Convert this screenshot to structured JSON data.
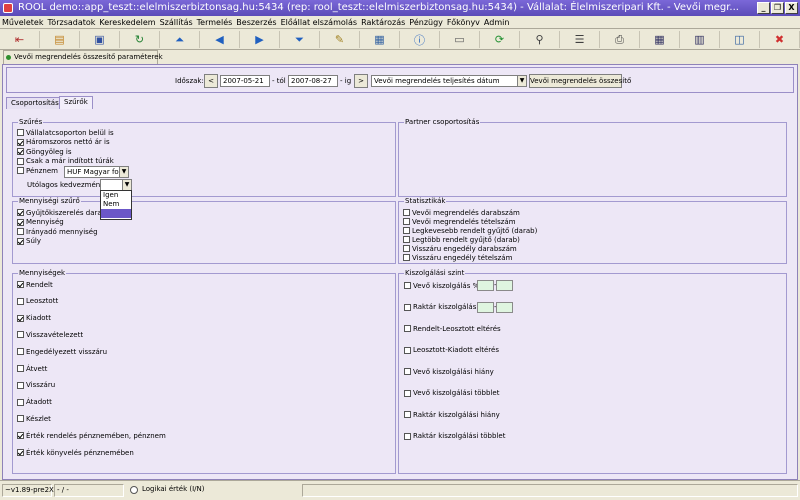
{
  "window": {
    "title": "ROOL demo::app_teszt::elelmiszerbiztonsag.hu:5434 (rep: rool_teszt::elelmiszerbiztonsag.hu:5434) - Vállalat: Élelmiszeripari Kft. - Vevői megr...",
    "minimize": "_",
    "restore": "❐",
    "close": "X"
  },
  "menu": [
    "Műveletek",
    "Törzsadatok",
    "Kereskedelem",
    "Szállítás",
    "Termelés",
    "Beszerzés",
    "Előállat elszámolás",
    "Raktározás",
    "Pénzügy",
    "Főkönyv",
    "Admin"
  ],
  "toolbar": [
    {
      "icon": "exit-icon",
      "glyph": "⇤",
      "color": "#b03030"
    },
    {
      "icon": "open-icon",
      "glyph": "▤",
      "color": "#c08020"
    },
    {
      "icon": "save-icon",
      "glyph": "▣",
      "color": "#3050a0"
    },
    {
      "icon": "refresh-icon",
      "glyph": "↻",
      "color": "#208030"
    },
    {
      "icon": "first-icon",
      "glyph": "⏶",
      "color": "#2060c0"
    },
    {
      "icon": "prev-icon",
      "glyph": "◀",
      "color": "#2060c0"
    },
    {
      "icon": "next-icon",
      "glyph": "▶",
      "color": "#2060c0"
    },
    {
      "icon": "last-icon",
      "glyph": "⏷",
      "color": "#2060c0"
    },
    {
      "icon": "edit-icon",
      "glyph": "✎",
      "color": "#a08020"
    },
    {
      "icon": "print-preview-icon",
      "glyph": "▦",
      "color": "#3060a0"
    },
    {
      "icon": "info-icon",
      "glyph": "ⓘ",
      "color": "#2060c0"
    },
    {
      "icon": "window-icon",
      "glyph": "▭",
      "color": "#606060"
    },
    {
      "icon": "sync-icon",
      "glyph": "⟳",
      "color": "#209030"
    },
    {
      "icon": "search-icon",
      "glyph": "⚲",
      "color": "#404040"
    },
    {
      "icon": "list-icon",
      "glyph": "☰",
      "color": "#404040"
    },
    {
      "icon": "print-icon",
      "glyph": "⎙",
      "color": "#404040"
    },
    {
      "icon": "grid-icon",
      "glyph": "▦",
      "color": "#303060"
    },
    {
      "icon": "table-icon",
      "glyph": "▥",
      "color": "#303060"
    },
    {
      "icon": "form-icon",
      "glyph": "◫",
      "color": "#3060a0"
    },
    {
      "icon": "close-icon",
      "glyph": "✖",
      "color": "#d03030"
    }
  ],
  "doc_tab": "Vevői megrendelés összesítő paraméterek",
  "params": {
    "period_label": "Időszak:",
    "from_date": "2007-05-21",
    "from_suffix": "- tól",
    "to_date": "2007-08-27",
    "to_suffix": "- ig",
    "prev": "<",
    "next": ">",
    "basis": "Vevői megrendelés teljesítés dátum",
    "run_button": "Vevői megrendelés összesítő"
  },
  "tabs": [
    "Csoportosítás",
    "Szűrők"
  ],
  "szures": {
    "title": "Szűrés",
    "items": [
      {
        "label": "Vállalatcsoporton belül is",
        "checked": false
      },
      {
        "label": "Háromszoros nettó ár is",
        "checked": true
      },
      {
        "label": "Göngyöleg is",
        "checked": true
      },
      {
        "label": "Csak a már indított túrák",
        "checked": false
      },
      {
        "label": "Pénznem",
        "checked": false
      }
    ],
    "currency": "HUF Magyar forint",
    "discount_label": "Utólagos kedvezmény?",
    "discount_options": [
      "Igen",
      "Nem",
      ""
    ]
  },
  "partner": {
    "title": "Partner csoportosítás"
  },
  "mennyisegi": {
    "title": "Mennyiségi szűrő",
    "items": [
      {
        "label": "Gyűjtőkiszerelés darab",
        "checked": true
      },
      {
        "label": "Mennyiség",
        "checked": true
      },
      {
        "label": "Irányadó mennyiség",
        "checked": false
      },
      {
        "label": "Súly",
        "checked": true
      }
    ]
  },
  "statisztikak": {
    "title": "Statisztikák",
    "items": [
      {
        "label": "Vevői megrendelés darabszám",
        "checked": false
      },
      {
        "label": "Vevői megrendelés tételszám",
        "checked": false
      },
      {
        "label": "Legkevesebb rendelt gyűjtő (darab)",
        "checked": false
      },
      {
        "label": "Legtöbb rendelt gyűjtő (darab)",
        "checked": false
      },
      {
        "label": "Visszáru engedély darabszám",
        "checked": false
      },
      {
        "label": "Visszáru engedély tételszám",
        "checked": false
      }
    ]
  },
  "mennyisegek": {
    "title": "Mennyiségek",
    "items": [
      {
        "label": "Rendelt",
        "checked": true
      },
      {
        "label": "Leosztott",
        "checked": false
      },
      {
        "label": "Kiadott",
        "checked": true
      },
      {
        "label": "Visszavételezett",
        "checked": false
      },
      {
        "label": "Engedélyezett visszáru",
        "checked": false
      },
      {
        "label": "Átvett",
        "checked": false
      },
      {
        "label": "Visszáru",
        "checked": false
      },
      {
        "label": "Átadott",
        "checked": false
      },
      {
        "label": "Készlet",
        "checked": false
      },
      {
        "label": "Érték rendelés pénznemében, pénznem",
        "checked": true
      },
      {
        "label": "Érték könyvelés pénznemében",
        "checked": true
      }
    ]
  },
  "kiszolgalasi": {
    "title": "Kiszolgálási szint",
    "items": [
      {
        "label": "Vevő kiszolgálás %",
        "checked": false,
        "range": true
      },
      {
        "label": "Raktár kiszolgálás %",
        "checked": false,
        "range": true
      },
      {
        "label": "Rendelt-Leosztott eltérés",
        "checked": false
      },
      {
        "label": "Leosztott-Kiadott eltérés",
        "checked": false
      },
      {
        "label": "Vevő kiszolgálási hiány",
        "checked": false
      },
      {
        "label": "Vevő kiszolgálási többlet",
        "checked": false
      },
      {
        "label": "Raktár kiszolgálási hiány",
        "checked": false
      },
      {
        "label": "Raktár kiszolgálási többlet",
        "checked": false
      }
    ],
    "range_sep": "-"
  },
  "status": {
    "version": "~v1.89-pre2X",
    "field2": "- / -",
    "logical_label": "Logikai érték (I/N)"
  }
}
